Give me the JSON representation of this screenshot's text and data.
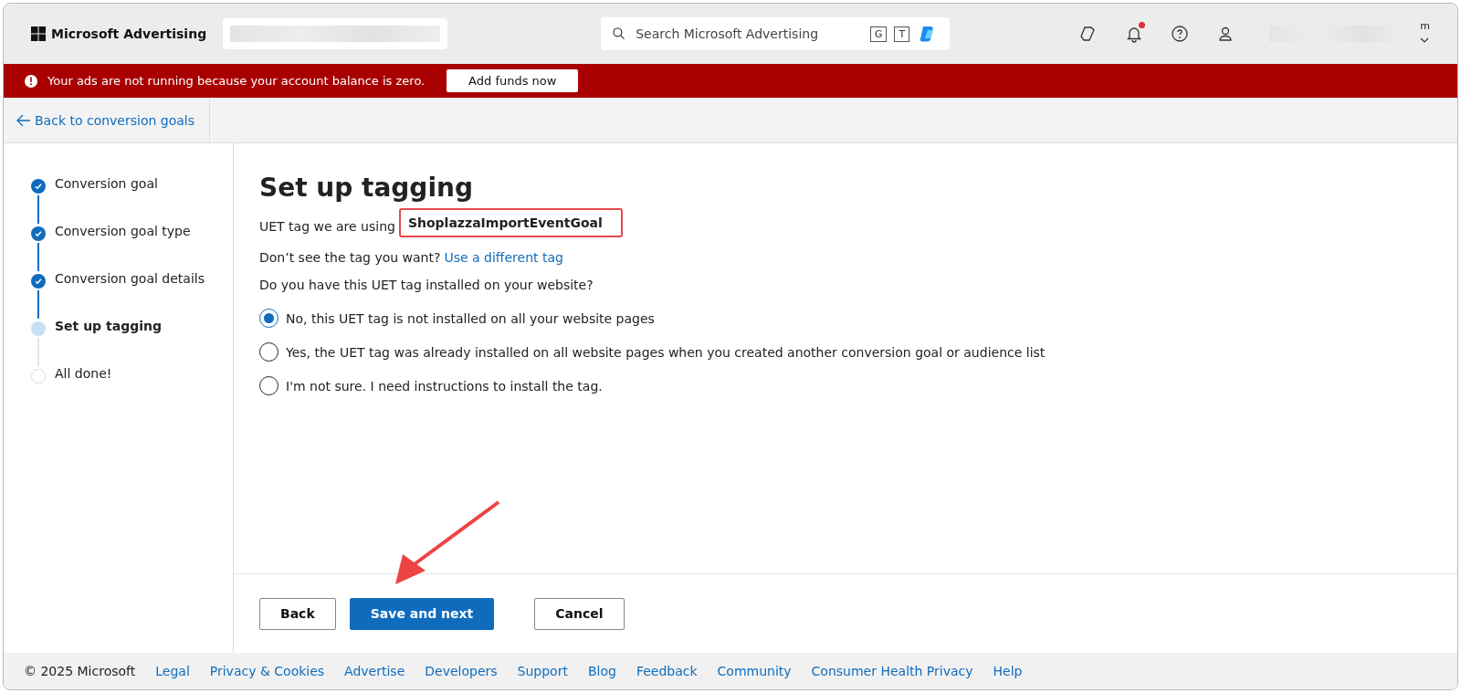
{
  "header": {
    "brand": "Microsoft Advertising",
    "search": {
      "placeholder": "Search Microsoft Advertising"
    },
    "search_keys": [
      "G",
      "T"
    ],
    "notifications": {
      "unread": true
    },
    "account_initial": "m"
  },
  "alert": {
    "message": "Your ads are not running because your account balance is zero.",
    "button": "Add funds now"
  },
  "back_link": "Back to conversion goals",
  "steps": [
    {
      "label": "Conversion goal",
      "kind": "done"
    },
    {
      "label": "Conversion goal type",
      "kind": "done"
    },
    {
      "label": "Conversion goal details",
      "kind": "done"
    },
    {
      "label": "Set up tagging",
      "kind": "current"
    },
    {
      "label": "All done!",
      "kind": "pending"
    }
  ],
  "content": {
    "title": "Set up tagging",
    "tag_label": "UET tag we are using",
    "tag_name": "ShoplazzaImportEventGoal",
    "tag_highlighted": true,
    "hint": "Don’t see the tag you want?",
    "hint_link": "Use a different tag",
    "question": "Do you have this UET tag installed on your website?",
    "options": [
      {
        "label": "No, this UET tag is not installed on all your website pages",
        "selected": true
      },
      {
        "label": "Yes, the UET tag was already installed on all website pages when you created another conversion goal or audience list",
        "selected": false
      },
      {
        "label": "I'm not sure. I need instructions to install the tag.",
        "selected": false
      }
    ]
  },
  "actions": [
    {
      "label": "Back",
      "kind": "secondary"
    },
    {
      "label": "Save and next",
      "kind": "primary"
    },
    {
      "label": "Cancel",
      "kind": "secondary"
    }
  ],
  "footer": {
    "copyright": "© 2025 Microsoft",
    "links": [
      "Legal",
      "Privacy & Cookies",
      "Advertise",
      "Developers",
      "Support",
      "Blog",
      "Feedback",
      "Community",
      "Consumer Health Privacy",
      "Help"
    ]
  }
}
